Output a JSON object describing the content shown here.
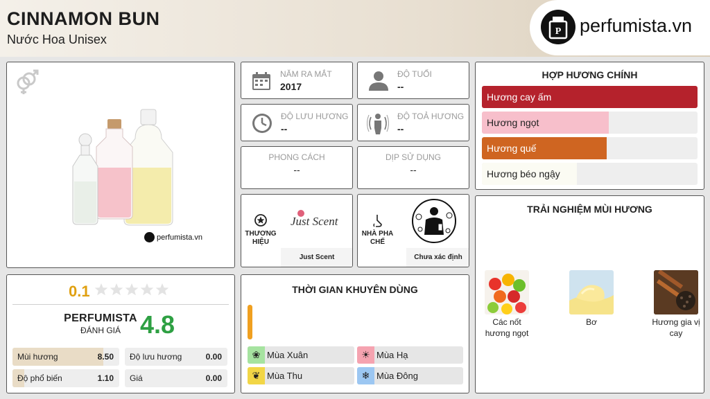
{
  "header": {
    "title": "CINNAMON BUN",
    "subtitle": "Nước Hoa Unisex",
    "logo_text": "perfumista.vn"
  },
  "product": {
    "watermark": "perfumista.vn",
    "gender_icon": "unisex-icon"
  },
  "info": {
    "release_label": "NĂM RA MẮT",
    "release_value": "2017",
    "age_label": "ĐỘ TUỔI",
    "age_value": "--",
    "longevity_label": "ĐỘ LƯU HƯƠNG",
    "longevity_value": "--",
    "sillage_label": "ĐỘ TOẢ HƯƠNG",
    "sillage_value": "--",
    "style_label": "PHONG CÁCH",
    "style_value": "--",
    "occasion_label": "DỊP SỬ DỤNG",
    "occasion_value": "--"
  },
  "brand": {
    "label_line1": "THƯƠNG",
    "label_line2": "HIỆU",
    "logo_text": "Just Scent",
    "name": "Just Scent"
  },
  "perfumer": {
    "label_line1": "NHÀ PHA",
    "label_line2": "CHẾ",
    "name": "Chưa xác định"
  },
  "accords": {
    "title": "HỢP HƯƠNG CHÍNH",
    "items": [
      {
        "label": "Hương cay ấm",
        "level": 1.0,
        "color": "#b5222c",
        "text_color": "#ffffff"
      },
      {
        "label": "Hương ngọt",
        "level": 0.59,
        "color": "#f7bfcb",
        "text_color": "#222222"
      },
      {
        "label": "Hương quế",
        "level": 0.58,
        "color": "#cf6521",
        "text_color": "#ffffff"
      },
      {
        "label": "Hương béo ngậy",
        "level": 0.44,
        "color": "#fbfbf3",
        "text_color": "#222222"
      }
    ]
  },
  "rating": {
    "user_score": "0.1",
    "stars_filled": 0,
    "stars_total": 5,
    "brand_line1": "PERFUMISTA",
    "brand_line2": "ĐÁNH GIÁ",
    "perfumista_score": "4.8",
    "rows": [
      {
        "label": "Mùi hương",
        "value": "8.50",
        "level": 0.85
      },
      {
        "label": "Độ lưu hương",
        "value": "0.00",
        "level": 0
      },
      {
        "label": "Độ phổ biến",
        "value": "1.10",
        "level": 0.11
      },
      {
        "label": "Giá",
        "value": "0.00",
        "level": 0
      }
    ]
  },
  "seasons": {
    "title": "THỜI GIAN KHUYÊN DÙNG",
    "day_night_level": 1.0,
    "items": [
      {
        "label": "Mùa Xuân",
        "icon": "flower-icon",
        "color": "#a6e3a0"
      },
      {
        "label": "Mùa Hạ",
        "icon": "sun-icon",
        "color": "#f5a3b0"
      },
      {
        "label": "Mùa Thu",
        "icon": "leaf-icon",
        "color": "#f2d646"
      },
      {
        "label": "Mùa Đông",
        "icon": "snowflake-icon",
        "color": "#9cc7f2"
      }
    ]
  },
  "experience": {
    "title": "TRẢI NGHIỆM MÙI HƯƠNG",
    "notes": [
      {
        "label_line1": "Các nốt",
        "label_line2": "hương ngọt"
      },
      {
        "label_line1": "Bơ",
        "label_line2": ""
      },
      {
        "label_line1": "Hương gia vị",
        "label_line2": "cay"
      }
    ]
  },
  "colors": {
    "accent_orange": "#f0a020",
    "score_green": "#2ea043",
    "user_score_yellow": "#e0a010",
    "rating_bar": "#e9dcc6"
  }
}
